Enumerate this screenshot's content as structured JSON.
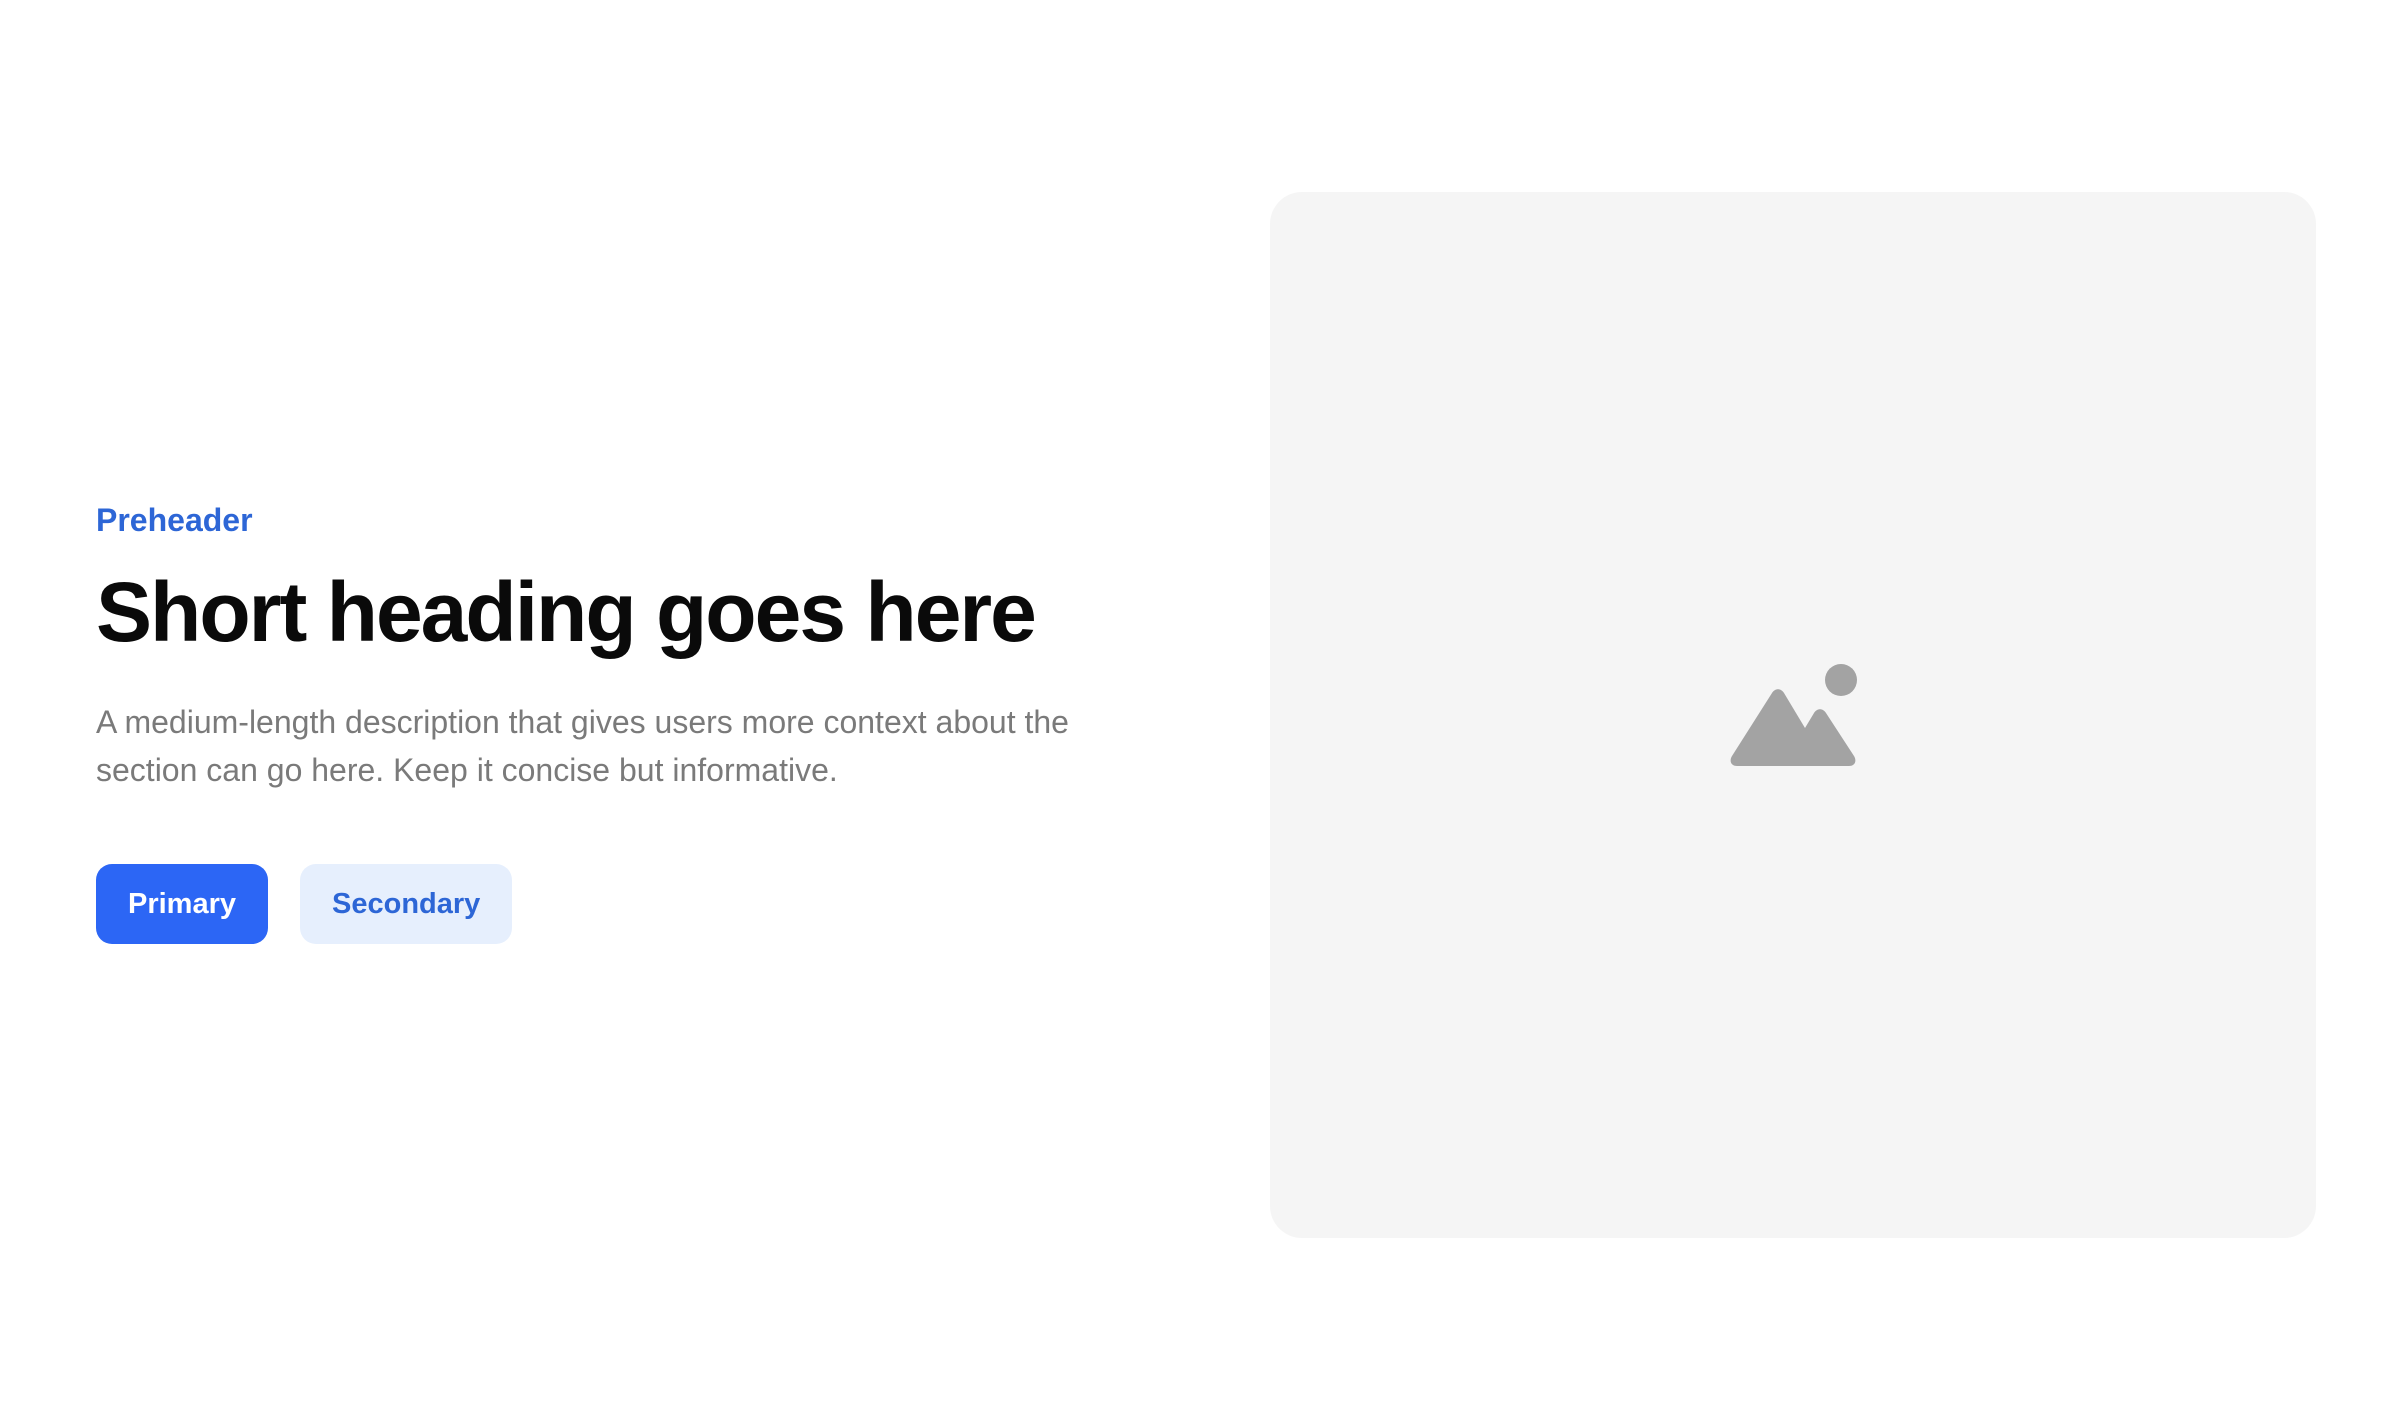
{
  "section": {
    "preheader": "Preheader",
    "heading": "Short heading goes here",
    "description": "A medium-length description that gives users more context about the section can go here. Keep it concise but informative."
  },
  "actions": {
    "primary_label": "Primary",
    "secondary_label": "Secondary"
  },
  "media": {
    "icon": "image-placeholder-icon"
  },
  "colors": {
    "accent": "#2d66d6",
    "primary_button": "#2c66f5",
    "secondary_button_bg": "#e6effd",
    "media_bg": "#f5f5f5",
    "media_icon": "#a3a3a3",
    "heading": "#0a0a0a",
    "body_text": "#7a7a7a"
  }
}
